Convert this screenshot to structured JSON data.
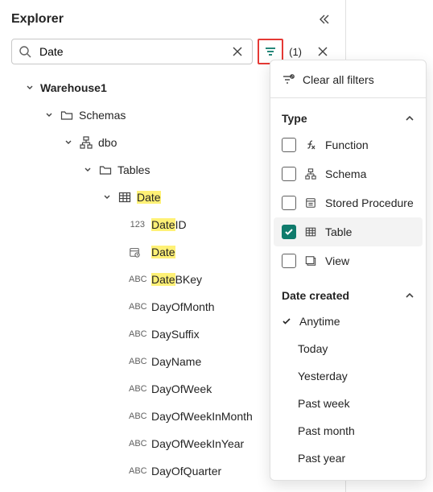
{
  "header": {
    "title": "Explorer"
  },
  "search": {
    "value": "Date",
    "filter_count": "(1)"
  },
  "tree": {
    "warehouse": "Warehouse1",
    "schemas": "Schemas",
    "dbo": "dbo",
    "tables": "Tables",
    "date_table": "Date",
    "cols": {
      "dateid_hl": "Date",
      "dateid_rest": "ID",
      "date_hl": "Date",
      "datebkey_hl": "Date",
      "datebkey_rest": "BKey",
      "dayofmonth": "DayOfMonth",
      "daysuffix": "DaySuffix",
      "dayname": "DayName",
      "dayofweek": "DayOfWeek",
      "dayofweekinmonth": "DayOfWeekInMonth",
      "dayofweekinyear": "DayOfWeekInYear",
      "dayofquarter": "DayOfQuarter"
    },
    "type_labels": {
      "num": "123",
      "abc": "ABC"
    }
  },
  "popover": {
    "clear": "Clear all filters",
    "type_header": "Type",
    "options": {
      "function": "Function",
      "schema": "Schema",
      "sproc": "Stored Procedure",
      "table": "Table",
      "view": "View"
    },
    "date_header": "Date created",
    "dates": {
      "anytime": "Anytime",
      "today": "Today",
      "yesterday": "Yesterday",
      "past_week": "Past week",
      "past_month": "Past month",
      "past_year": "Past year"
    }
  }
}
